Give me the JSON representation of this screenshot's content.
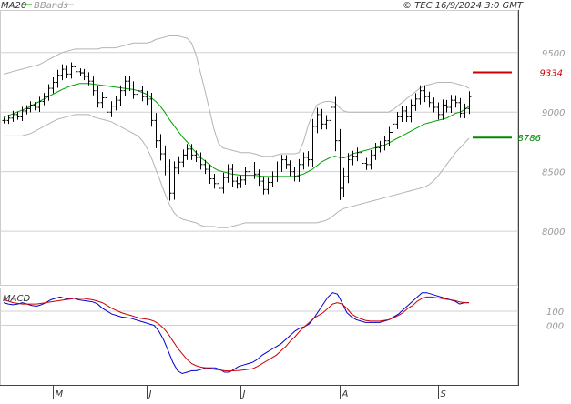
{
  "header": {
    "legend_ma": "MA20",
    "legend_bb": "BBands",
    "source": "© TEC 16/9/2024 3:0 GMT"
  },
  "colors": {
    "bar": "#000000",
    "ma20": "#00a000",
    "bands": "#b4b4b4",
    "grid": "#d0d0d0",
    "target_high": "#cc0000",
    "target_low": "#008800",
    "macd_line": "#0000cc",
    "signal_line": "#cc0000",
    "axis_text": "#999999"
  },
  "chart_data": [
    {
      "type": "ohlc",
      "ylim": [
        7550,
        9850
      ],
      "yticks": [
        8000,
        8500,
        9000,
        9500
      ],
      "ytick_labels": [
        "8000",
        "8500",
        "9000",
        "9500"
      ],
      "x_labels": [
        "M",
        "J",
        "J",
        "A",
        "S"
      ],
      "x_label_index": [
        11,
        32,
        53,
        75,
        97
      ],
      "grid": true,
      "target_high": {
        "value": 9334,
        "label": "9334"
      },
      "target_low": {
        "value": 8786,
        "label": "8786"
      },
      "closes": [
        8930,
        8950,
        8980,
        8960,
        9010,
        9030,
        9060,
        9040,
        9090,
        9130,
        9200,
        9250,
        9310,
        9360,
        9320,
        9380,
        9340,
        9330,
        9300,
        9260,
        9180,
        9080,
        9120,
        9000,
        9050,
        9100,
        9180,
        9260,
        9220,
        9150,
        9180,
        9130,
        9110,
        8930,
        8760,
        8650,
        8540,
        8320,
        8530,
        8580,
        8640,
        8690,
        8640,
        8620,
        8560,
        8520,
        8440,
        8400,
        8360,
        8450,
        8520,
        8420,
        8400,
        8430,
        8500,
        8540,
        8480,
        8420,
        8350,
        8410,
        8460,
        8540,
        8600,
        8560,
        8500,
        8460,
        8560,
        8620,
        8600,
        8880,
        8980,
        8900,
        8930,
        9040,
        8760,
        8360,
        8460,
        8600,
        8630,
        8660,
        8570,
        8560,
        8640,
        8700,
        8720,
        8760,
        8830,
        8900,
        8960,
        9010,
        8960,
        9060,
        9110,
        9180,
        9130,
        9080,
        9040,
        8980,
        9060,
        9040,
        9100,
        9080,
        8990,
        9030,
        9130
      ],
      "ranges": [
        70,
        80,
        90,
        70,
        100,
        80,
        90,
        70,
        110,
        90,
        100,
        120,
        130,
        120,
        100,
        110,
        90,
        80,
        90,
        100,
        110,
        120,
        140,
        110,
        120,
        100,
        130,
        120,
        120,
        110,
        100,
        110,
        140,
        150,
        180,
        160,
        200,
        180,
        160,
        140,
        130,
        120,
        120,
        110,
        120,
        110,
        120,
        120,
        110,
        120,
        120,
        130,
        120,
        110,
        110,
        120,
        120,
        110,
        120,
        110,
        120,
        130,
        120,
        110,
        100,
        120,
        130,
        120,
        150,
        180,
        160,
        130,
        130,
        170,
        250,
        280,
        200,
        160,
        130,
        120,
        120,
        130,
        120,
        120,
        110,
        120,
        130,
        120,
        120,
        120,
        120,
        130,
        140,
        130,
        130,
        120,
        120,
        120,
        130,
        120,
        130,
        120,
        110,
        120,
        130
      ],
      "ma20": [
        8960,
        8970,
        8985,
        9000,
        9015,
        9030,
        9050,
        9070,
        9090,
        9110,
        9130,
        9150,
        9170,
        9190,
        9205,
        9220,
        9230,
        9240,
        9240,
        9240,
        9235,
        9230,
        9225,
        9220,
        9215,
        9210,
        9205,
        9200,
        9195,
        9190,
        9180,
        9165,
        9150,
        9120,
        9090,
        9050,
        9000,
        8940,
        8890,
        8840,
        8790,
        8750,
        8700,
        8660,
        8620,
        8590,
        8560,
        8530,
        8510,
        8500,
        8490,
        8480,
        8475,
        8470,
        8470,
        8470,
        8470,
        8465,
        8460,
        8460,
        8460,
        8460,
        8460,
        8460,
        8460,
        8460,
        8470,
        8480,
        8500,
        8520,
        8550,
        8580,
        8600,
        8620,
        8630,
        8620,
        8615,
        8630,
        8650,
        8660,
        8670,
        8680,
        8690,
        8700,
        8710,
        8720,
        8740,
        8760,
        8780,
        8800,
        8820,
        8840,
        8860,
        8880,
        8900,
        8910,
        8920,
        8930,
        8940,
        8950,
        8970,
        8990,
        9000,
        9020,
        9050
      ],
      "bb_upper": [
        9320,
        9330,
        9340,
        9350,
        9360,
        9370,
        9380,
        9390,
        9400,
        9420,
        9440,
        9460,
        9480,
        9500,
        9510,
        9520,
        9530,
        9530,
        9530,
        9530,
        9530,
        9530,
        9540,
        9540,
        9540,
        9540,
        9550,
        9560,
        9570,
        9580,
        9580,
        9580,
        9580,
        9590,
        9610,
        9620,
        9630,
        9640,
        9640,
        9640,
        9630,
        9620,
        9580,
        9480,
        9330,
        9180,
        9020,
        8860,
        8740,
        8700,
        8690,
        8680,
        8670,
        8660,
        8660,
        8660,
        8650,
        8640,
        8630,
        8630,
        8630,
        8640,
        8650,
        8650,
        8650,
        8650,
        8660,
        8750,
        8880,
        8980,
        9060,
        9080,
        9090,
        9090,
        9080,
        9040,
        9010,
        9000,
        9000,
        9000,
        9000,
        9000,
        9000,
        9000,
        9000,
        9000,
        9000,
        9020,
        9050,
        9080,
        9110,
        9140,
        9170,
        9200,
        9220,
        9230,
        9240,
        9250,
        9250,
        9250,
        9250,
        9240,
        9230,
        9220,
        9200
      ],
      "bb_lower": [
        8800,
        8800,
        8800,
        8800,
        8800,
        8810,
        8820,
        8840,
        8860,
        8880,
        8900,
        8920,
        8940,
        8950,
        8960,
        8970,
        8980,
        8980,
        8980,
        8980,
        8960,
        8950,
        8940,
        8930,
        8920,
        8900,
        8880,
        8860,
        8840,
        8820,
        8800,
        8760,
        8700,
        8620,
        8520,
        8420,
        8320,
        8230,
        8160,
        8120,
        8100,
        8090,
        8080,
        8070,
        8050,
        8040,
        8040,
        8040,
        8030,
        8030,
        8030,
        8040,
        8050,
        8060,
        8070,
        8070,
        8070,
        8070,
        8070,
        8070,
        8070,
        8070,
        8070,
        8070,
        8070,
        8070,
        8070,
        8070,
        8070,
        8070,
        8070,
        8080,
        8090,
        8110,
        8140,
        8170,
        8190,
        8200,
        8210,
        8220,
        8230,
        8240,
        8250,
        8260,
        8270,
        8280,
        8290,
        8300,
        8310,
        8320,
        8330,
        8340,
        8350,
        8360,
        8370,
        8390,
        8420,
        8460,
        8510,
        8560,
        8610,
        8660,
        8700,
        8740,
        8780
      ]
    },
    {
      "type": "line",
      "title": "MACD",
      "ylim": [
        -420,
        260
      ],
      "yticks": [
        100,
        0
      ],
      "ytick_labels": [
        "100",
        "000"
      ],
      "series": [
        {
          "values": [
            160,
            150,
            145,
            150,
            160,
            150,
            140,
            135,
            145,
            160,
            180,
            190,
            200,
            190,
            185,
            190,
            180,
            175,
            170,
            165,
            150,
            120,
            100,
            80,
            70,
            60,
            55,
            50,
            40,
            30,
            20,
            10,
            0,
            -40,
            -100,
            -180,
            -260,
            -320,
            -340,
            -330,
            -320,
            -320,
            -310,
            -300,
            -300,
            -300,
            -310,
            -330,
            -330,
            -310,
            -290,
            -280,
            -270,
            -260,
            -240,
            -210,
            -190,
            -170,
            -150,
            -130,
            -100,
            -70,
            -40,
            -20,
            -10,
            10,
            50,
            100,
            150,
            200,
            230,
            220,
            160,
            90,
            60,
            40,
            30,
            20,
            20,
            20,
            20,
            30,
            40,
            60,
            80,
            110,
            140,
            170,
            200,
            230,
            230,
            220,
            210,
            200,
            190,
            180,
            170,
            150,
            160,
            160
          ]
        },
        {
          "values": [
            180,
            170,
            160,
            155,
            150,
            150,
            150,
            150,
            155,
            160,
            165,
            170,
            175,
            180,
            185,
            190,
            190,
            190,
            185,
            180,
            170,
            160,
            140,
            120,
            105,
            90,
            80,
            70,
            60,
            50,
            45,
            40,
            30,
            10,
            -20,
            -60,
            -110,
            -160,
            -200,
            -240,
            -270,
            -285,
            -295,
            -300,
            -305,
            -310,
            -315,
            -320,
            -322,
            -320,
            -318,
            -315,
            -310,
            -305,
            -290,
            -270,
            -250,
            -230,
            -210,
            -180,
            -150,
            -110,
            -80,
            -40,
            -10,
            20,
            50,
            70,
            90,
            120,
            150,
            160,
            150,
            120,
            80,
            60,
            45,
            35,
            30,
            30,
            30,
            35,
            40,
            55,
            70,
            90,
            120,
            140,
            170,
            190,
            200,
            200,
            195,
            190,
            185,
            180,
            175,
            165,
            160,
            160
          ]
        }
      ]
    }
  ]
}
